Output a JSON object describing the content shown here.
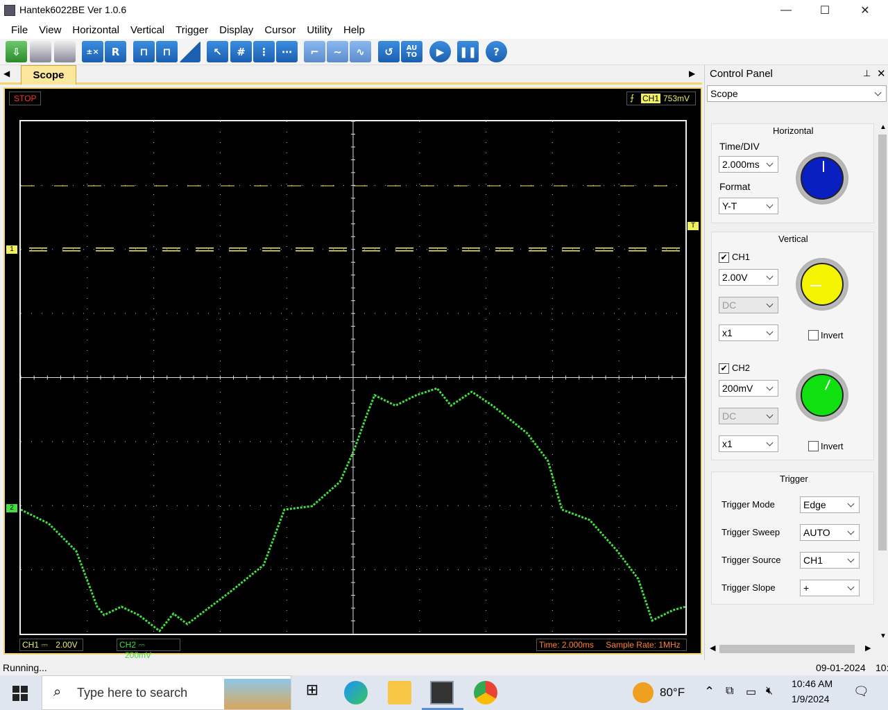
{
  "window": {
    "title": "Hantek6022BE Ver 1.0.6",
    "min": "—",
    "max": "☐",
    "close": "✕"
  },
  "menu": [
    "File",
    "View",
    "Horizontal",
    "Vertical",
    "Trigger",
    "Display",
    "Cursor",
    "Utility",
    "Help"
  ],
  "toolbar": {
    "icons": [
      "open-icon",
      "save-icon",
      "print-icon",
      "measure-icon",
      "reference-icon",
      "ch1-icon",
      "ch2-icon",
      "math-icon",
      "cursor-icon",
      "grid-icon",
      "split-icon",
      "dash-icon",
      "step-icon",
      "wave-icon",
      "sine-icon",
      "rotate-icon",
      "auto-icon",
      "run-icon",
      "pause-icon",
      "help-icon"
    ],
    "r_label": "R",
    "auto_label": "AU TO",
    "help_label": "?"
  },
  "tabs": {
    "scope": "Scope"
  },
  "scope": {
    "state": "STOP",
    "trigger_channel": "CH1",
    "trigger_level": "753mV",
    "trigger_marker": "T",
    "ch1_marker": "1",
    "ch2_marker": "2",
    "bottom": {
      "ch1_label": "CH1",
      "ch1_scale": "2.00V",
      "ch2_label": "CH2",
      "ch2_scale": "200mV",
      "time": "Time: 2.000ms",
      "sample_rate": "Sample Rate: 1MHz"
    },
    "colors": {
      "ch1": "#f0f060",
      "ch2": "#40e040",
      "grid": "#c8c8c8",
      "state": "#ff3030",
      "info": "#ff8030"
    }
  },
  "control_panel": {
    "title": "Control Panel",
    "mode": "Scope",
    "horizontal": {
      "heading": "Horizontal",
      "time_div_label": "Time/DIV",
      "time_div": "2.000ms",
      "format_label": "Format",
      "format": "Y-T",
      "knob_color": "#0a1fbf"
    },
    "vertical": {
      "heading": "Vertical",
      "ch1": {
        "name": "CH1",
        "checked": true,
        "volts": "2.00V",
        "coupling": "DC",
        "probe": "x1",
        "invert_label": "Invert",
        "knob_color": "#f4f400"
      },
      "ch2": {
        "name": "CH2",
        "checked": true,
        "volts": "200mV",
        "coupling": "DC",
        "probe": "x1",
        "invert_label": "Invert",
        "knob_color": "#10e010"
      }
    },
    "trigger": {
      "heading": "Trigger",
      "mode_label": "Trigger Mode",
      "mode": "Edge",
      "sweep_label": "Trigger Sweep",
      "sweep": "AUTO",
      "source_label": "Trigger Source",
      "source": "CH1",
      "slope_label": "Trigger Slope",
      "slope": "+"
    }
  },
  "status": {
    "text": "Running...",
    "date": "09-01-2024",
    "extra": "10:"
  },
  "taskbar": {
    "search_placeholder": "Type here to search",
    "temperature": "80°F",
    "time": "10:46 AM",
    "date": "1/9/2024"
  }
}
